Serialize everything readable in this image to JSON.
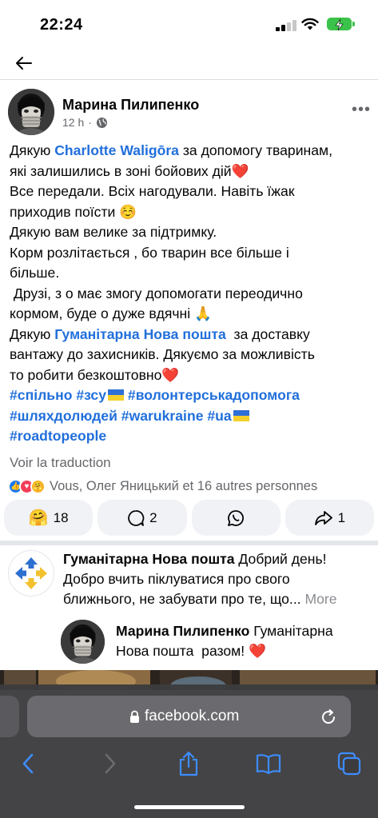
{
  "status_bar": {
    "time": "22:24"
  },
  "post": {
    "author": "Марина Пилипенко",
    "time": "12 h",
    "body": {
      "l1_pre": "Дякую ",
      "l1_link": "Charlotte Waligōra",
      "l1_post": " за допомогу тваринам,",
      "l2": "які залишились в зоні бойових дій",
      "l3": "Все передали. Всіх нагодували. Навіть їжак",
      "l4": "приходив поїсти",
      "l5": "Дякую вам велике за підтримку.",
      "l6": "Корм розлітається , бо тварин все більше і",
      "l7": "більше.",
      "l8": " Друзі, з о має змогу допомогати переодично",
      "l9": "кормом, буде о дуже вдячні",
      "l10_pre": "Дякую ",
      "l10_link": "Гуманітарна Нова пошта",
      "l10_post": "  за доставку",
      "l11": "вантажу до захисників. Дякуємо за можливість",
      "l12": "то робити безкоштовно",
      "tags1_a": "#спільно",
      "tags1_b": "#зсу",
      "tags1_c": "#волонтерськадопомога",
      "tags2_a": "#шляхдолюдей",
      "tags2_b": "#warukraine",
      "tags2_c": "#ua",
      "tags3": "#roadtopeople"
    },
    "translate": "Voir la traduction",
    "reactions_text": "Vous, Олег Яницький et 16 autres personnes",
    "actions": {
      "reactions_count": "18",
      "comments_count": "2",
      "shares_count": "1"
    }
  },
  "comments": [
    {
      "author": "Гуманітарна Нова пошта",
      "text_line1": " Добрий день!",
      "text_line2": "Добро вчить піклуватися про свого",
      "text_line3": "ближнього, не забувати про те, що...",
      "more": " More"
    },
    {
      "author": "Марина Пилипенко",
      "text_line1": " Гуманітарна",
      "text_line2": "Нова пошта  разом!"
    }
  ],
  "browser": {
    "url": "facebook.com"
  },
  "colors": {
    "link": "#216fdb",
    "secondary": "#65676b",
    "battery": "#3bc24a",
    "safari_bar": "#3c3c3e"
  },
  "icons": [
    "back-arrow-icon",
    "globe-icon",
    "more-icon",
    "heart-icon",
    "like-icon",
    "care-icon",
    "comment-icon",
    "whatsapp-icon",
    "share-icon",
    "lock-icon",
    "reload-icon",
    "browser-back-icon",
    "browser-forward-icon",
    "share-sheet-icon",
    "bookmarks-icon",
    "tabs-icon"
  ]
}
